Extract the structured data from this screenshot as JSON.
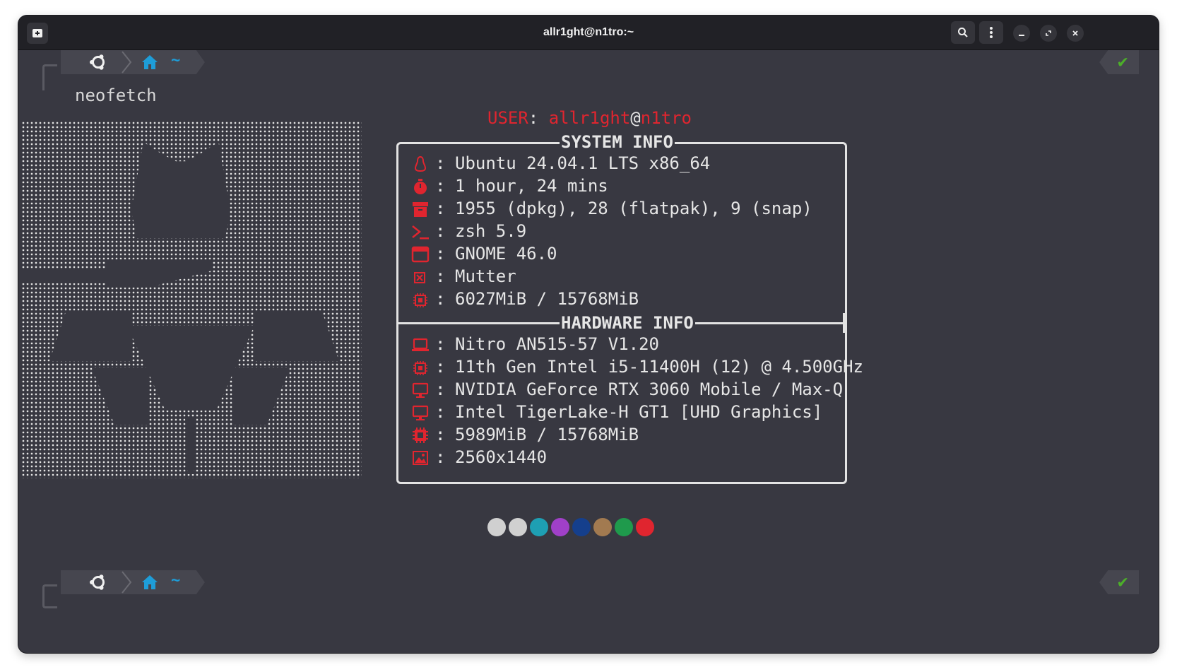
{
  "window": {
    "title": "allr1ght@n1tro:~"
  },
  "prompt": {
    "path": "~",
    "command": "neofetch",
    "status": "✔"
  },
  "user": {
    "label": "USER",
    "name": "allr1ght",
    "at": "@",
    "host": "n1tro"
  },
  "system_info": {
    "header": "SYSTEM INFO",
    "rows": [
      {
        "icon": "linux-icon",
        "value": "Ubuntu 24.04.1 LTS x86_64"
      },
      {
        "icon": "stopwatch-icon",
        "value": "1 hour, 24 mins"
      },
      {
        "icon": "package-icon",
        "value": "1955 (dpkg), 28 (flatpak), 9 (snap)"
      },
      {
        "icon": "terminal-icon",
        "value": "zsh 5.9"
      },
      {
        "icon": "window-icon",
        "value": "GNOME 46.0"
      },
      {
        "icon": "close-box-icon",
        "value": "Mutter"
      },
      {
        "icon": "chip-icon",
        "value": "6027MiB / 15768MiB"
      }
    ]
  },
  "hardware_info": {
    "header": "HARDWARE INFO",
    "rows": [
      {
        "icon": "laptop-icon",
        "value": "Nitro AN515-57 V1.20"
      },
      {
        "icon": "cpu-icon",
        "value": "11th Gen Intel i5-11400H (12) @ 4.500GHz"
      },
      {
        "icon": "monitor-icon",
        "value": "NVIDIA GeForce RTX 3060 Mobile / Max-Q"
      },
      {
        "icon": "monitor-icon",
        "value": "Intel TigerLake-H GT1 [UHD Graphics]"
      },
      {
        "icon": "memory-icon",
        "value": "5989MiB / 15768MiB"
      },
      {
        "icon": "image-icon",
        "value": "2560x1440"
      }
    ]
  },
  "palette": [
    "#d0d0d0",
    "#d0d0d0",
    "#1e9fb3",
    "#a040c8",
    "#153f8c",
    "#a27a50",
    "#1f9a4c",
    "#e0252f"
  ],
  "colors": {
    "accent_red": "#e0252f",
    "terminal_bg": "#383841",
    "tilde_blue": "#1e9dd8",
    "check_green": "#4caf29"
  }
}
